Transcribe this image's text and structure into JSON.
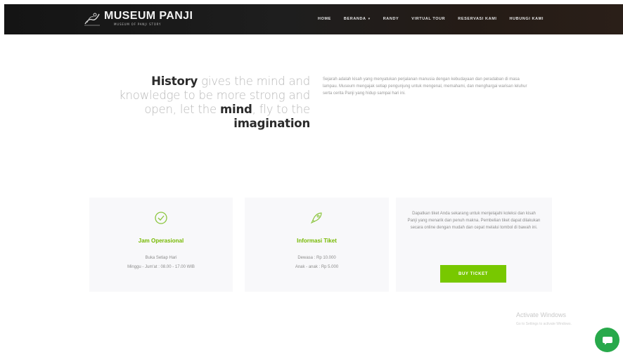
{
  "brand": {
    "title": "MUSEUM PANJI",
    "subtitle": "MUSEUM OF PANJI STORY"
  },
  "nav": {
    "items": [
      {
        "label": "HOME"
      },
      {
        "label": "BERANDA",
        "has_dropdown": true
      },
      {
        "label": "RANDY"
      },
      {
        "label": "VIRTUAL TOUR"
      },
      {
        "label": "RESERVASI KAMI"
      },
      {
        "label": "HUBUNGI KAMI"
      }
    ]
  },
  "quote": {
    "w1": "History",
    "w2": " gives the mind and knowledge to be more strong and open,",
    "w3": " let the ",
    "w4": "mind",
    "w5": ", fly to the ",
    "w6": "imagination"
  },
  "intro": {
    "text": "Sejarah adalah kisah yang menyatukan perjalanan manusia dengan kebudayaan dan peradaban di masa lampau. Museum mengajak setiap pengunjung untuk mengenal, memahami, dan menghargai warisan leluhur serta cerita Panji yang hidup sampai hari ini."
  },
  "cards": {
    "hours": {
      "icon": "clock-icon",
      "title": "Jam Operasional",
      "line1": "Buka Setiap Hari",
      "line2": "Minggu - Jum'at : 08.00 - 17.00 WIB"
    },
    "ticket_info": {
      "icon": "rocket-icon",
      "title": "Informasi Tiket",
      "line1": "Dewasa : Rp 10.000",
      "line2": "Anak - anak : Rp 5.000"
    },
    "buy": {
      "text": "Dapatkan tiket Anda sekarang untuk menjelajahi koleksi dan kisah Panji yang menarik dan penuh makna. Pembelian tiket dapat dilakukan secara online dengan mudah dan cepat melalui tombol di bawah ini.",
      "button_label": "BUY TICKET"
    }
  },
  "watermark": {
    "title": "Activate Windows",
    "subtitle": "Go to Settings to activate Windows."
  },
  "colors": {
    "accent": "#78c800",
    "chat": "#28a94b",
    "nav_bg": "#1a1a1a"
  }
}
